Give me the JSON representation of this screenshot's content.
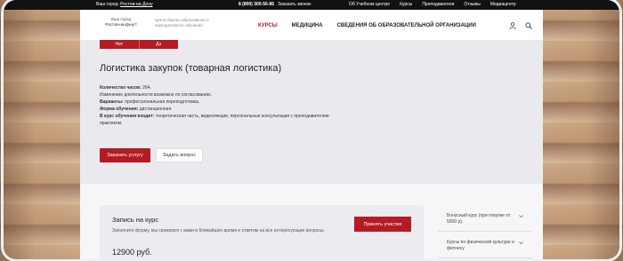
{
  "topbar": {
    "city_label": "Ваш город:",
    "city": "Ростов-на-Дону",
    "phone": "8 (800) 300-56-86",
    "callback": "Заказать звонок",
    "links": [
      "Об Учебном центре",
      "Курсы",
      "Преподаватели",
      "Отзывы",
      "Медиацентр"
    ]
  },
  "header": {
    "logo_city_label": "Ваш город",
    "logo_city": "Ростов-на-Дону?",
    "tagline": "Центр бизнес-образования и корпоративного обучения",
    "nav": [
      "КУРСЫ",
      "МЕДИЦИНА",
      "СВЕДЕНИЯ ОБ ОБРАЗОВАТЕЛЬНОЙ ОРГАНИЗАЦИИ"
    ]
  },
  "city_popup": {
    "no": "Нет",
    "yes": "Да"
  },
  "course": {
    "title": "Логистика закупок (товарная логистика)",
    "hours_label": "Количество часов:",
    "hours": "264.",
    "duration_note": "Изменение длительности возможно по согласованию.",
    "variants_label": "Варианты:",
    "variants": "профессиональная переподготовка.",
    "form_label": "Форма обучения:",
    "form": "дистанционная.",
    "includes_label": "В курс обучения входит:",
    "includes": "теоретическая часть, видеолекции, персональные консультации с преподавателем-практиком.",
    "order_button": "Заказать услугу",
    "ask_button": "Задать вопрос"
  },
  "signup": {
    "title": "Запись на курс",
    "description": "Заполните форму, мы свяжемся с вами в ближайшее время и ответим на все интересующие вопросы.",
    "price": "12900 руб.",
    "apply_button": "Принять участие"
  },
  "sidebar": {
    "items": [
      "Бонусный курс (при покупке от 5000 р).",
      "Курсы по физической культуре и фитнесу"
    ]
  },
  "colors": {
    "accent": "#b31b25",
    "topbar": "#111111"
  }
}
